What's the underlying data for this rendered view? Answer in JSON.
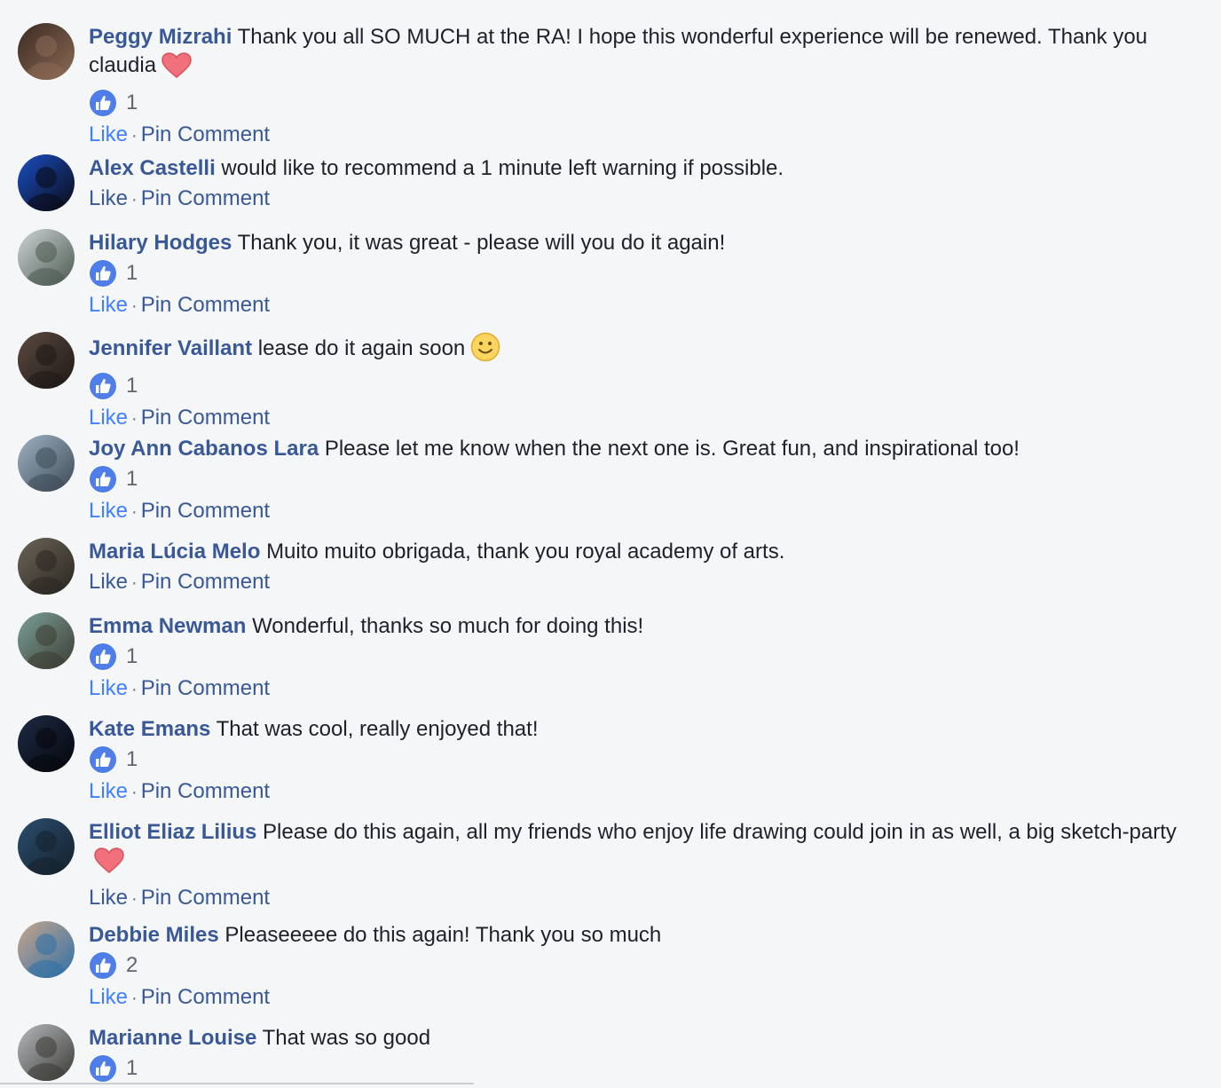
{
  "comments": [
    {
      "author": "Peggy Mizrahi",
      "text": "Thank you all SO MUCH at the RA! I hope this wonderful experience will be renewed. Thank you claudia",
      "emoji": "heart",
      "likes": "1",
      "liked": true,
      "like_label": "Like",
      "pin_label": "Pin Comment",
      "avatar_colors": [
        "#3a2a22",
        "#8c6a55"
      ]
    },
    {
      "author": "Alex Castelli",
      "text": "would like to recommend a 1 minute left warning if possible.",
      "emoji": "",
      "likes": "",
      "liked": false,
      "like_label": "Like",
      "pin_label": "Pin Comment",
      "avatar_colors": [
        "#1a4fc4",
        "#0a0a14"
      ]
    },
    {
      "author": "Hilary Hodges",
      "text": "Thank you, it was great - please will you do it again!",
      "emoji": "",
      "likes": "1",
      "liked": true,
      "like_label": "Like",
      "pin_label": "Pin Comment",
      "avatar_colors": [
        "#cfd3d6",
        "#4a5a50"
      ]
    },
    {
      "author": "Jennifer Vaillant",
      "text": "lease do it again soon",
      "emoji": "smile",
      "likes": "1",
      "liked": true,
      "like_label": "Like",
      "pin_label": "Pin Comment",
      "avatar_colors": [
        "#5c4a40",
        "#1e1816"
      ]
    },
    {
      "author": "Joy Ann Cabanos Lara",
      "text": "Please let me know when the next one is. Great fun, and inspirational too!",
      "emoji": "",
      "likes": "1",
      "liked": true,
      "like_label": "Like",
      "pin_label": "Pin Comment",
      "avatar_colors": [
        "#9fb3c4",
        "#3d4a55"
      ]
    },
    {
      "author": "Maria Lúcia Melo",
      "text": "Muito muito obrigada, thank you royal academy of arts.",
      "emoji": "",
      "likes": "",
      "liked": false,
      "like_label": "Like",
      "pin_label": "Pin Comment",
      "avatar_colors": [
        "#6b6457",
        "#2a2620"
      ]
    },
    {
      "author": "Emma Newman",
      "text": "Wonderful, thanks so much for doing this!",
      "emoji": "",
      "likes": "1",
      "liked": true,
      "like_label": "Like",
      "pin_label": "Pin Comment",
      "avatar_colors": [
        "#7aa09a",
        "#3d3d32"
      ]
    },
    {
      "author": "Kate Emans",
      "text": "That was cool, really enjoyed that!",
      "emoji": "",
      "likes": "1",
      "liked": true,
      "like_label": "Like",
      "pin_label": "Pin Comment",
      "avatar_colors": [
        "#1e2a44",
        "#05070c"
      ]
    },
    {
      "author": "Elliot Eliaz Lilius",
      "text": "Please do this again, all my friends who enjoy life drawing could join in as well, a big sketch-party",
      "emoji": "heart",
      "likes": "",
      "liked": false,
      "like_label": "Like",
      "pin_label": "Pin Comment",
      "avatar_colors": [
        "#2b4e6e",
        "#14202c"
      ]
    },
    {
      "author": "Debbie Miles",
      "text": "Pleaseeeee do this again! Thank you so much",
      "emoji": "",
      "likes": "2",
      "liked": true,
      "like_label": "Like",
      "pin_label": "Pin Comment",
      "avatar_colors": [
        "#c9a68a",
        "#2e6fa8"
      ]
    },
    {
      "author": "Marianne Louise",
      "text": "That was so good",
      "emoji": "",
      "likes": "1",
      "liked": true,
      "like_label": "",
      "pin_label": "",
      "avatar_colors": [
        "#b7b9bd",
        "#3b3a36"
      ]
    }
  ]
}
